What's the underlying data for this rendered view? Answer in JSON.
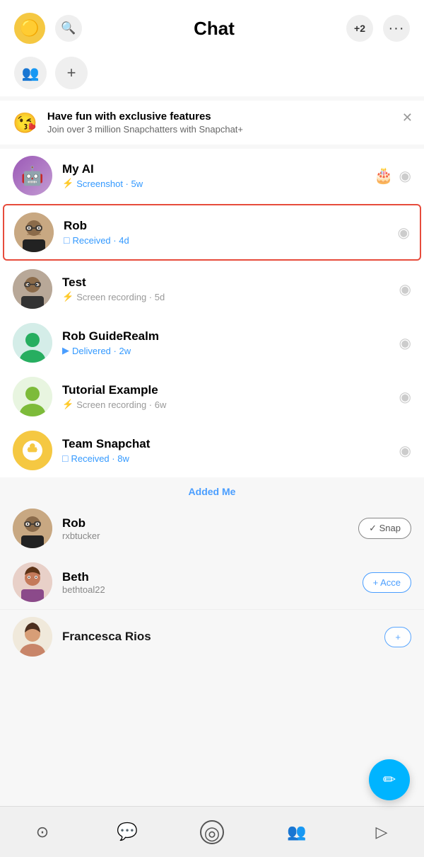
{
  "header": {
    "title": "Chat",
    "add_friend_label": "+2",
    "more_label": "···"
  },
  "promo": {
    "emoji": "😘",
    "title": "Have fun with exclusive features",
    "subtitle": "Join over 3 million Snapchatters with Snapchat+"
  },
  "chats": [
    {
      "name": "My AI",
      "status": "Screenshot · 5w",
      "status_type": "blue",
      "avatar_type": "ai",
      "action": "camera"
    },
    {
      "name": "Rob",
      "status": "Received · 4d",
      "status_type": "blue",
      "avatar_type": "rob1",
      "highlighted": true,
      "action": "camera"
    },
    {
      "name": "Test",
      "status": "Screen recording · 5d",
      "status_type": "grey",
      "avatar_type": "test",
      "action": "camera"
    },
    {
      "name": "Rob GuideRealm",
      "status": "Delivered · 2w",
      "status_type": "blue",
      "avatar_type": "rob2",
      "action": "camera"
    },
    {
      "name": "Tutorial Example",
      "status": "Screen recording · 6w",
      "status_type": "grey",
      "avatar_type": "tutorial",
      "action": "camera"
    },
    {
      "name": "Team Snapchat",
      "status": "Received · 8w",
      "status_type": "blue",
      "avatar_type": "snapchat",
      "action": "camera"
    }
  ],
  "added_me_label": "Added Me",
  "added_me": [
    {
      "name": "Rob",
      "username": "rxbtucker",
      "avatar_type": "rob3",
      "action_label": "✓ Snap"
    },
    {
      "name": "Beth",
      "username": "bethtoal22",
      "avatar_type": "beth",
      "action_label": "+ Acce"
    },
    {
      "name": "Francesca Rios",
      "username": "",
      "avatar_type": "francesca",
      "action_label": "+"
    }
  ],
  "nav": {
    "items": [
      {
        "icon": "⊙",
        "label": "map"
      },
      {
        "icon": "💬",
        "label": "chat",
        "active": true
      },
      {
        "icon": "◎",
        "label": "camera"
      },
      {
        "icon": "👥",
        "label": "friends"
      },
      {
        "icon": "▷",
        "label": "stories"
      }
    ]
  },
  "fab_icon": "✏"
}
